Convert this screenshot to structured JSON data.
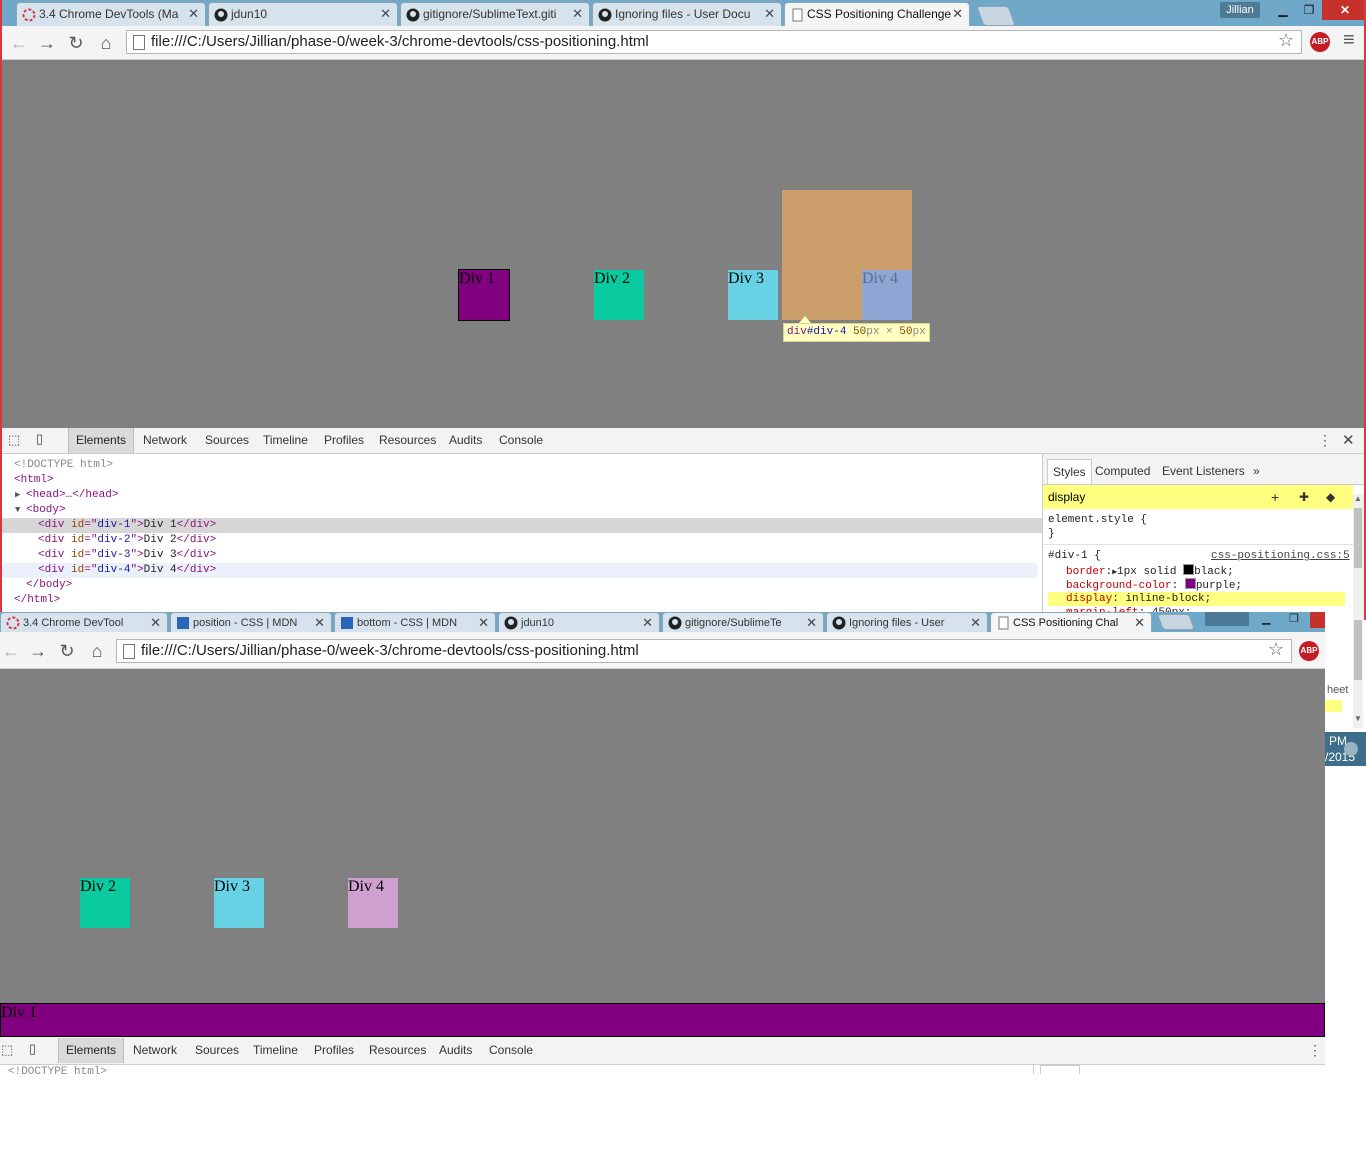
{
  "window1": {
    "tabs": [
      {
        "title": "3.4 Chrome DevTools (Ma",
        "icon": "loading-icon"
      },
      {
        "title": "jdun10",
        "icon": "github-icon"
      },
      {
        "title": "gitignore/SublimeText.giti",
        "icon": "github-icon"
      },
      {
        "title": "Ignoring files - User Docu",
        "icon": "github-icon"
      },
      {
        "title": "CSS Positioning Challenge",
        "icon": "page-icon"
      }
    ],
    "user_badge": "Jillian",
    "url": "file:///C:/Users/Jillian/phase-0/week-3/chrome-devtools/css-positioning.html",
    "boxes": [
      {
        "label": "Div 1",
        "color": "#800080"
      },
      {
        "label": "Div 2",
        "color": "#0acb9f"
      },
      {
        "label": "Div 3",
        "color": "#66d2e4"
      },
      {
        "label": "Div 4",
        "color": "#8ea6d4"
      }
    ],
    "tooltip": {
      "tag": "div",
      "id": "#div-4",
      "w": "50",
      "unit": "px",
      "x": "×",
      "h": "50"
    },
    "devtools": {
      "tabs": [
        "Elements",
        "Network",
        "Sources",
        "Timeline",
        "Profiles",
        "Resources",
        "Audits",
        "Console"
      ],
      "dom": {
        "doctype": "<!DOCTYPE html>",
        "html_open": "<html>",
        "head": "<head>…</head>",
        "body_open": "<body>",
        "divs": [
          {
            "id": "div-1",
            "text": "Div 1"
          },
          {
            "id": "div-2",
            "text": "Div 2"
          },
          {
            "id": "div-3",
            "text": "Div 3"
          },
          {
            "id": "div-4",
            "text": "Div 4"
          }
        ],
        "body_close": "</body>",
        "html_close": "</html>"
      },
      "styles_tabs": [
        "Styles",
        "Computed",
        "Event Listeners"
      ],
      "filter_text": "display",
      "element_style": "element.style {",
      "close_brace": "}",
      "rule_selector": "#div-1 {",
      "rule_source": "css-positioning.css:5",
      "properties": [
        {
          "name": "border",
          "value": "1px solid",
          "swatch": "#000000",
          "swatch_label": "black;"
        },
        {
          "name": "background-color",
          "value": "",
          "swatch": "#800080",
          "swatch_label": "purple;"
        },
        {
          "name": "display",
          "value": "inline-block;"
        },
        {
          "name": "margin-left",
          "value": "450px;"
        }
      ]
    }
  },
  "window2": {
    "tabs": [
      {
        "title": "3.4 Chrome DevTool",
        "icon": "loading-icon"
      },
      {
        "title": "position - CSS | MDN",
        "icon": "mdn-icon"
      },
      {
        "title": "bottom - CSS | MDN",
        "icon": "mdn-icon"
      },
      {
        "title": "jdun10",
        "icon": "github-icon"
      },
      {
        "title": "gitignore/SublimeTe",
        "icon": "github-icon"
      },
      {
        "title": "Ignoring files - User",
        "icon": "github-icon"
      },
      {
        "title": "CSS Positioning Chal",
        "icon": "page-icon"
      }
    ],
    "url": "file:///C:/Users/Jillian/phase-0/week-3/chrome-devtools/css-positioning.html",
    "boxes": [
      {
        "label": "Div 2",
        "color": "#0acb9f"
      },
      {
        "label": "Div 3",
        "color": "#66d2e4"
      },
      {
        "label": "Div 4",
        "color": "#cfa0cf"
      }
    ],
    "footer_div": {
      "label": "Div 1",
      "color": "#800080"
    },
    "devtools_tabs": [
      "Elements",
      "Network",
      "Sources",
      "Timeline",
      "Profiles",
      "Resources",
      "Audits",
      "Console"
    ],
    "doctype_partial": "<!DOCTYPE html>"
  },
  "stray": {
    "sheet": "heet",
    "time": "PM",
    "year": "/2015"
  }
}
